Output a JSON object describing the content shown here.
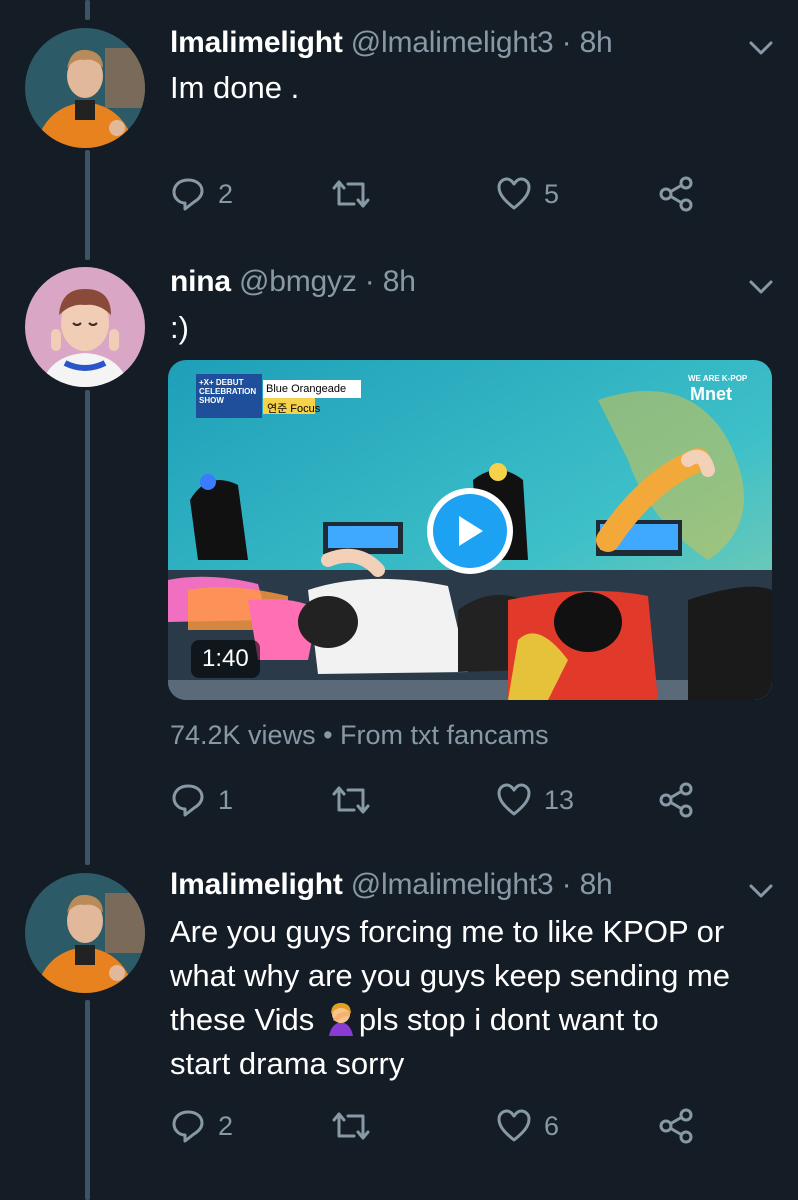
{
  "tweets": [
    {
      "name": "lmalimelight",
      "handle": "@lmalimelight3",
      "sep": " · ",
      "time": "8h",
      "text": "Im done .",
      "replies": "2",
      "likes": "5"
    },
    {
      "name": "nina",
      "handle": "@bmgyz",
      "sep": " · ",
      "time": "8h",
      "text": ":)",
      "replies": "1",
      "likes": "13",
      "media": {
        "duration": "1:40",
        "views": "74.2K views",
        "dot": " • ",
        "source": "From txt fancams",
        "overlay_show": "+X+ DEBUT CELEBRATION SHOW",
        "overlay_song": "Blue Orangeade",
        "overlay_perf": "연준 Focus",
        "overlay_brand": "Mnet",
        "overlay_tag": "WE ARE K-POP"
      }
    },
    {
      "name": "lmalimelight",
      "handle": "@lmalimelight3",
      "sep": " · ",
      "time": "8h",
      "text_line1": "Are you guys forcing me to like KPOP or",
      "text_line2": "what why are you guys keep sending me",
      "text_line3a": "these Vids ",
      "emoji": "woman-facepalming",
      "text_line3b": "pls stop i dont want to",
      "text_line4": "start drama sorry",
      "replies": "2",
      "likes": "6"
    }
  ],
  "colors": {
    "background": "#141d26",
    "muted": "#8899a6",
    "thread_line": "#3d5466",
    "accent": "#1da1f2"
  }
}
